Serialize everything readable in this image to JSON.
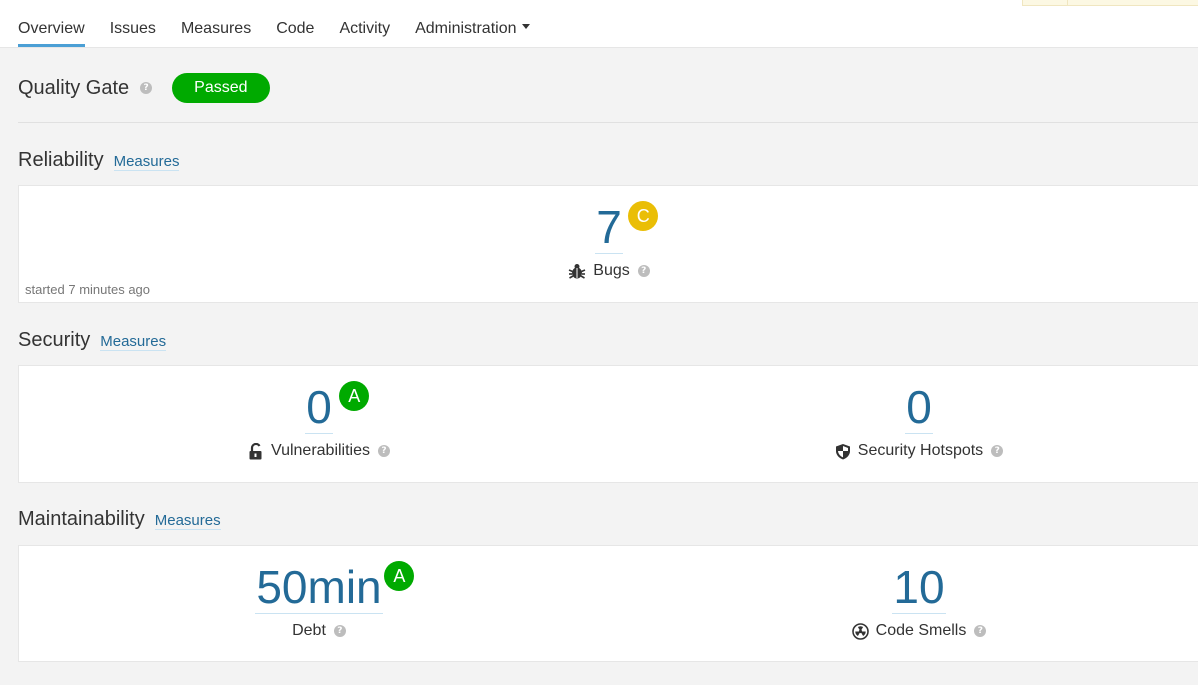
{
  "nav": {
    "tabs": [
      {
        "label": "Overview"
      },
      {
        "label": "Issues"
      },
      {
        "label": "Measures"
      },
      {
        "label": "Code"
      },
      {
        "label": "Activity"
      },
      {
        "label": "Administration"
      }
    ]
  },
  "quality_gate": {
    "title": "Quality Gate",
    "status": "Passed",
    "status_color": "#00aa00"
  },
  "reliability": {
    "title": "Reliability",
    "measures_link": "Measures",
    "started": "started 7 minutes ago",
    "bugs": {
      "value": "7",
      "rating": "C",
      "label": "Bugs",
      "icon": "bug-icon"
    }
  },
  "security": {
    "title": "Security",
    "measures_link": "Measures",
    "vulnerabilities": {
      "value": "0",
      "rating": "A",
      "label": "Vulnerabilities",
      "icon": "unlock-icon"
    },
    "hotspots": {
      "value": "0",
      "label": "Security Hotspots",
      "icon": "shield-icon"
    }
  },
  "maintainability": {
    "title": "Maintainability",
    "measures_link": "Measures",
    "debt": {
      "value": "50min",
      "rating": "A",
      "label": "Debt"
    },
    "code_smells": {
      "value": "10",
      "label": "Code Smells",
      "icon": "radiation-icon"
    }
  },
  "colors": {
    "accent": "#236a97",
    "tab_underline": "#4b9fd5",
    "rating_a": "#00aa00",
    "rating_c": "#eabe06"
  }
}
